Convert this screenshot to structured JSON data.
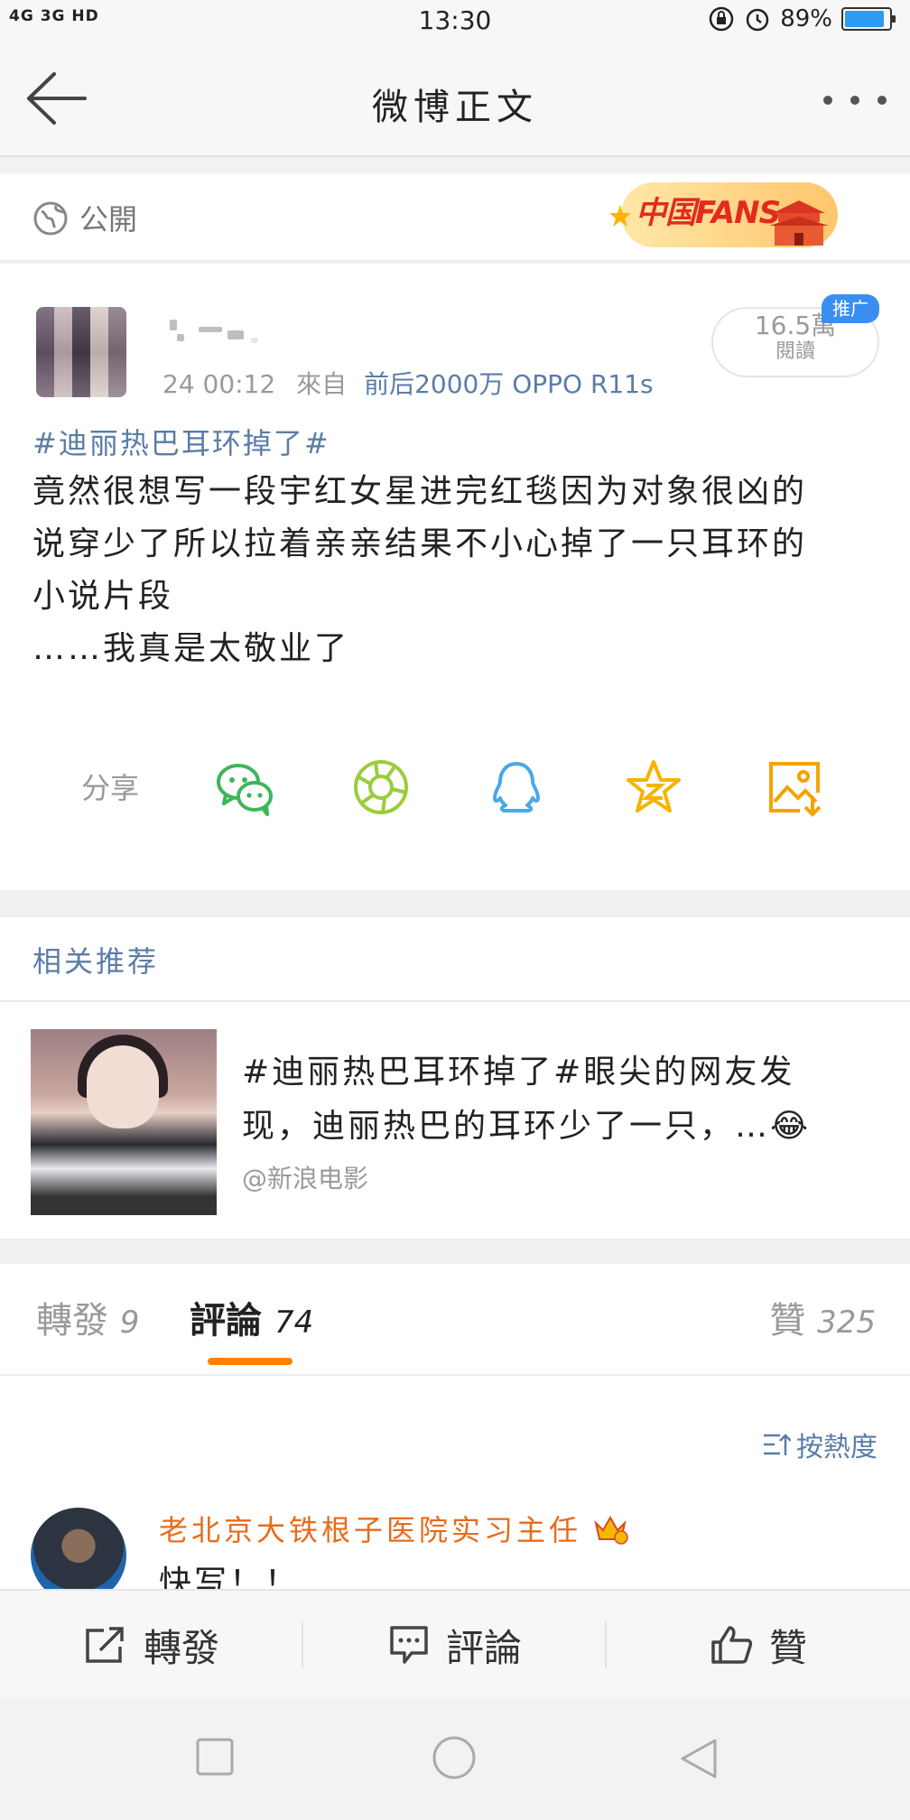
{
  "status_bar": {
    "network": "4G 3G HD",
    "time": "13:30",
    "battery": "89%",
    "battery_level": 0.89
  },
  "nav": {
    "title": "微博正文"
  },
  "post": {
    "visibility": "公開",
    "badge_text": "中国FANS",
    "meta_time": "24 00:12",
    "meta_from": "來自",
    "meta_source": "前后2000万 OPPO R11s",
    "reads_count": "16.5萬",
    "reads_label": "閱讀",
    "promo": "推广",
    "topic": "#迪丽热巴耳环掉了#",
    "content_line1": "竟然很想写一段宇红女星进完红毯因为对象很凶的",
    "content_line2": "说穿少了所以拉着亲亲结果不小心掉了一只耳环的",
    "content_line3": "小说片段",
    "content_line4": "……我真是太敬业了",
    "share_label": "分享"
  },
  "related": {
    "heading": "相关推荐",
    "text_line1": "#迪丽热巴耳环掉了#眼尖的网友发",
    "text_line2": "现，迪丽热巴的耳环少了一只，…😂",
    "source": "@新浪电影"
  },
  "tabs": {
    "repost_label": "轉發",
    "repost_count": "9",
    "comment_label": "評論",
    "comment_count": "74",
    "like_label": "贊",
    "like_count": "325"
  },
  "comments": {
    "sort_label": "按熱度",
    "items": [
      {
        "user": "老北京大铁根子医院实习主任",
        "text": "快写！！"
      }
    ]
  },
  "actions": {
    "repost": "轉發",
    "comment": "評論",
    "like": "贊"
  },
  "colors": {
    "link_blue": "#5b7ca8",
    "accent_orange": "#ff8200",
    "promo_blue": "#3a8ef0"
  }
}
